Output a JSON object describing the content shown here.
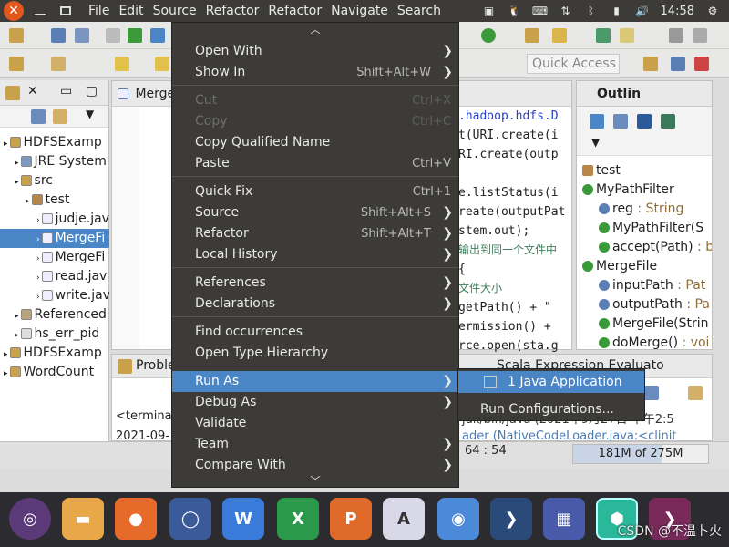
{
  "topbar": {
    "menus": [
      "File",
      "Edit",
      "Source",
      "Refactor",
      "Refactor",
      "Navigate",
      "Search"
    ],
    "time": "14:58"
  },
  "toolbar": {
    "quick_access": "Quick Access"
  },
  "package_explorer": {
    "rows": [
      {
        "label": "HDFSExamp",
        "indent": 0
      },
      {
        "label": "JRE System",
        "indent": 1
      },
      {
        "label": "src",
        "indent": 1
      },
      {
        "label": "test",
        "indent": 2
      },
      {
        "label": "judje.jav",
        "indent": 3
      },
      {
        "label": "MergeFi",
        "indent": 3,
        "selected": true
      },
      {
        "label": "MergeFi",
        "indent": 3
      },
      {
        "label": "read.jav",
        "indent": 3
      },
      {
        "label": "write.jav",
        "indent": 3
      },
      {
        "label": "Referenced",
        "indent": 1
      },
      {
        "label": "hs_err_pid",
        "indent": 1
      },
      {
        "label": "HDFSExamp",
        "indent": 0
      },
      {
        "label": "WordCount",
        "indent": 0
      }
    ]
  },
  "editor": {
    "tab_label": "Merge",
    "lines": [
      ".hadoop.hdfs.D",
      "t(URI.create(i",
      "RI.create(outp",
      "",
      "e.listStatus(i",
      "reate(outputPat",
      "stem.out);",
      "输出到同一个文件中",
      " {",
      "文件大小",
      "getPath() + \"",
      "ermission() +",
      "rce.open(sta.g"
    ]
  },
  "outline": {
    "title": "Outlin",
    "rows": [
      {
        "label": "test",
        "type": ""
      },
      {
        "label": "MyPathFilter",
        "type": ""
      },
      {
        "label": "reg",
        "type": " : String"
      },
      {
        "label": "MyPathFilter(S",
        "type": ""
      },
      {
        "label": "accept(Path)",
        "type": " : b"
      },
      {
        "label": "MergeFile",
        "type": ""
      },
      {
        "label": "inputPath",
        "type": " : Pat"
      },
      {
        "label": "outputPath",
        "type": " : Pa"
      },
      {
        "label": "MergeFile(Strin",
        "type": ""
      },
      {
        "label": "doMerge()",
        "type": " : voi"
      }
    ]
  },
  "console": {
    "tab_problems": "Proble",
    "tab_scala": "Scala Expression Evaluato",
    "line1": "<termina",
    "line2": "2021-09-",
    "right1": "jdk/bin/java (2021年9月27日 下午2:5",
    "right2": "ader (NativeCodeLoader.java:<clinit"
  },
  "status": {
    "position": "64 : 54",
    "heap": "181M of 275M",
    "heap_used_fraction": 0.658
  },
  "context_menu": {
    "items": [
      {
        "label": "Open With",
        "shortcut": "",
        "submenu": true,
        "disabled": false
      },
      {
        "label": "Show In",
        "shortcut": "Shift+Alt+W",
        "submenu": true,
        "disabled": false
      },
      {
        "label": "Cut",
        "shortcut": "Ctrl+X",
        "submenu": false,
        "disabled": true
      },
      {
        "label": "Copy",
        "shortcut": "Ctrl+C",
        "submenu": false,
        "disabled": true
      },
      {
        "label": "Copy Qualified Name",
        "shortcut": "",
        "submenu": false,
        "disabled": false
      },
      {
        "label": "Paste",
        "shortcut": "Ctrl+V",
        "submenu": false,
        "disabled": false
      },
      {
        "label": "Quick Fix",
        "shortcut": "Ctrl+1",
        "submenu": false,
        "disabled": false
      },
      {
        "label": "Source",
        "shortcut": "Shift+Alt+S",
        "submenu": true,
        "disabled": false
      },
      {
        "label": "Refactor",
        "shortcut": "Shift+Alt+T",
        "submenu": true,
        "disabled": false
      },
      {
        "label": "Local History",
        "shortcut": "",
        "submenu": true,
        "disabled": false
      },
      {
        "label": "References",
        "shortcut": "",
        "submenu": true,
        "disabled": false
      },
      {
        "label": "Declarations",
        "shortcut": "",
        "submenu": true,
        "disabled": false
      },
      {
        "label": "Find occurrences",
        "shortcut": "",
        "submenu": false,
        "disabled": false
      },
      {
        "label": "Open Type Hierarchy",
        "shortcut": "",
        "submenu": false,
        "disabled": false
      },
      {
        "label": "Run As",
        "shortcut": "",
        "submenu": true,
        "disabled": false,
        "highlighted": true
      },
      {
        "label": "Debug As",
        "shortcut": "",
        "submenu": true,
        "disabled": false
      },
      {
        "label": "Validate",
        "shortcut": "",
        "submenu": false,
        "disabled": false
      },
      {
        "label": "Team",
        "shortcut": "",
        "submenu": true,
        "disabled": false
      },
      {
        "label": "Compare With",
        "shortcut": "",
        "submenu": true,
        "disabled": false
      }
    ]
  },
  "run_as_submenu": {
    "items": [
      "1 Java Application",
      "Run Configurations..."
    ]
  },
  "watermark": "CSDN @不温卜火",
  "colors": {
    "menu_bg": "#3c3b37",
    "highlight": "#4a86c6",
    "close_button": "#e2571e"
  }
}
